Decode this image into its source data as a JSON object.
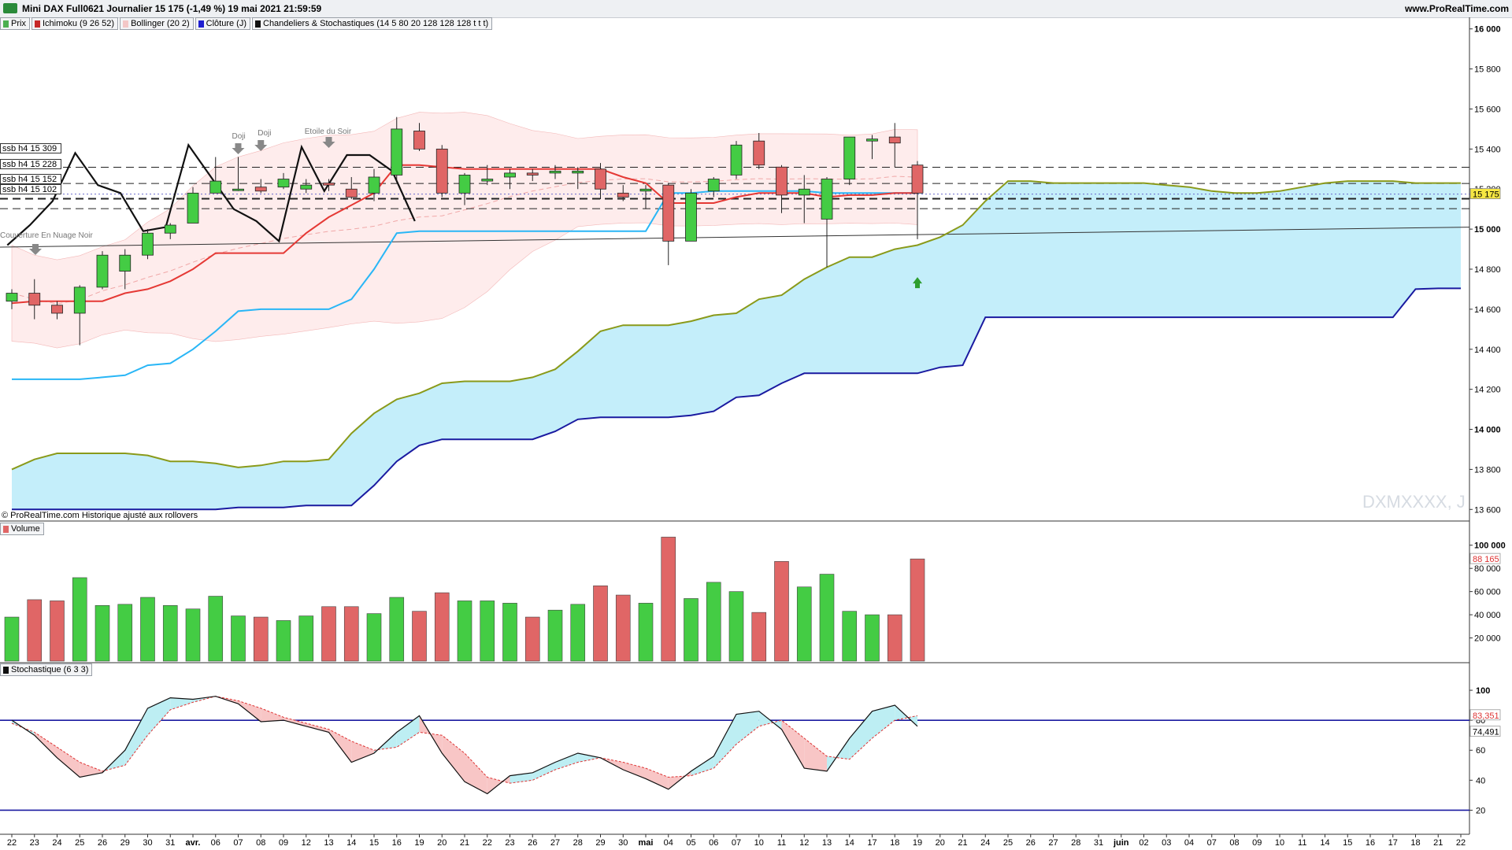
{
  "header": {
    "title": "Mini DAX Full0621 Journalier 15 175 (-1,49 %) 19 mai 2021 21:59:59",
    "site": "www.ProRealTime.com"
  },
  "legend": [
    {
      "label": "Prix",
      "color": "#4caf50"
    },
    {
      "label": "Ichimoku (9 26 52)",
      "color": "#c62828"
    },
    {
      "label": "Bollinger (20 2)",
      "color": "#f4c7c7"
    },
    {
      "label": "Clôture (J)",
      "color": "#1f1fd0"
    },
    {
      "label": "Chandeliers & Stochastiques (14 5 80 20 128 128 128 t t t)",
      "color": "#111111"
    }
  ],
  "footnote": "© ProRealTime.com Historique ajusté aux rollovers",
  "watermark": "DXMXXXX, J",
  "ssb_labels": [
    "ssb h4 15 309",
    "ssb h4 15 228",
    "ssb h4 15 152",
    "ssb h4 15 102"
  ],
  "annotations": {
    "doji1": "Doji",
    "doji2": "Doji",
    "etoile": "Etoile du Soir",
    "nuage": "Couverture En Nuage Noir",
    "last_price_tag": "15 175"
  },
  "volume_tag": "Volume",
  "stoch_tag": "Stochastique (6 3 3)",
  "colors": {
    "up": "#44cc44",
    "down": "#e06666",
    "tenkan": "#e53935",
    "kijun": "#29b6f6",
    "ssa": "#8a9a1a",
    "ssb": "#1a1aa0",
    "cloud": "#c4eefa",
    "boll": "#fde6e6",
    "stoch": "#111111"
  },
  "chart_data": [
    {
      "type": "candlestick",
      "x_labels": [
        "22",
        "23",
        "24",
        "25",
        "26",
        "29",
        "30",
        "31",
        "avr.",
        "06",
        "07",
        "08",
        "09",
        "12",
        "13",
        "14",
        "15",
        "16",
        "19",
        "20",
        "21",
        "22",
        "23",
        "26",
        "27",
        "28",
        "29",
        "30",
        "mai",
        "04",
        "05",
        "06",
        "07",
        "10",
        "11",
        "12",
        "13",
        "14",
        "17",
        "18",
        "19",
        "20",
        "21",
        "24",
        "25",
        "26",
        "27",
        "28",
        "31",
        "juin",
        "02",
        "03",
        "04",
        "07",
        "08",
        "09",
        "10",
        "11",
        "14",
        "15",
        "16",
        "17",
        "18",
        "21",
        "22"
      ],
      "ylim": [
        13550,
        16050
      ],
      "y_ticks": [
        "13 600",
        "13 800",
        "14 000",
        "14 200",
        "14 400",
        "14 600",
        "14 800",
        "15 000",
        "15 200",
        "15 400",
        "15 600",
        "15 800",
        "16 000"
      ],
      "candles": [
        [
          14640,
          14700,
          14600,
          14680
        ],
        [
          14680,
          14750,
          14550,
          14620
        ],
        [
          14620,
          14640,
          14550,
          14580
        ],
        [
          14580,
          14720,
          14420,
          14710
        ],
        [
          14710,
          14890,
          14700,
          14870
        ],
        [
          14790,
          14900,
          14700,
          14870
        ],
        [
          14870,
          15000,
          14850,
          14980
        ],
        [
          14980,
          15030,
          14950,
          15020
        ],
        [
          15030,
          15210,
          15040,
          15180
        ],
        [
          15180,
          15360,
          15180,
          15240
        ],
        [
          15200,
          15360,
          15190,
          15200
        ],
        [
          15210,
          15250,
          15180,
          15190
        ],
        [
          15210,
          15280,
          15200,
          15250
        ],
        [
          15200,
          15250,
          15180,
          15220
        ],
        [
          15230,
          15250,
          15190,
          15220
        ],
        [
          15200,
          15260,
          15150,
          15160
        ],
        [
          15180,
          15300,
          15140,
          15260
        ],
        [
          15270,
          15560,
          15240,
          15500
        ],
        [
          15490,
          15530,
          15390,
          15400
        ],
        [
          15400,
          15420,
          15160,
          15180
        ],
        [
          15180,
          15280,
          15120,
          15270
        ],
        [
          15240,
          15320,
          15220,
          15250
        ],
        [
          15260,
          15300,
          15200,
          15280
        ],
        [
          15280,
          15300,
          15240,
          15270
        ],
        [
          15280,
          15320,
          15250,
          15290
        ],
        [
          15280,
          15310,
          15200,
          15290
        ],
        [
          15300,
          15330,
          15150,
          15200
        ],
        [
          15180,
          15220,
          15140,
          15160
        ],
        [
          15190,
          15220,
          15100,
          15200
        ],
        [
          15220,
          15230,
          14820,
          14940
        ],
        [
          14940,
          15200,
          14940,
          15180
        ],
        [
          15190,
          15260,
          15160,
          15250
        ],
        [
          15270,
          15440,
          15250,
          15420
        ],
        [
          15440,
          15480,
          15300,
          15320
        ],
        [
          15310,
          15320,
          15080,
          15170
        ],
        [
          15170,
          15270,
          15030,
          15200
        ],
        [
          15050,
          15260,
          14810,
          15250
        ],
        [
          15250,
          15460,
          15220,
          15460
        ],
        [
          15440,
          15470,
          15350,
          15450
        ],
        [
          15460,
          15530,
          15310,
          15430
        ],
        [
          15320,
          15340,
          14950,
          15180
        ]
      ],
      "last_index": 40
    },
    {
      "type": "line",
      "name": "ichimoku",
      "tenkan": [
        14630,
        14640,
        14640,
        14640,
        14640,
        14680,
        14700,
        14740,
        14800,
        14880,
        14880,
        14880,
        14880,
        14980,
        15060,
        15120,
        15180,
        15320,
        15320,
        15310,
        15300,
        15300,
        15300,
        15300,
        15300,
        15300,
        15300,
        15260,
        15230,
        15130,
        15130,
        15130,
        15160,
        15180,
        15180,
        15180,
        15160,
        15170,
        15170,
        15180,
        15180
      ],
      "kijun": [
        14250,
        14250,
        14250,
        14250,
        14260,
        14270,
        14320,
        14330,
        14400,
        14490,
        14590,
        14600,
        14600,
        14600,
        14600,
        14650,
        14800,
        14980,
        14990,
        14990,
        14990,
        14990,
        14990,
        14990,
        14990,
        14990,
        14990,
        14990,
        14990,
        15180,
        15180,
        15190,
        15190,
        15190,
        15190,
        15190,
        15180,
        15180,
        15180,
        15180,
        15180
      ],
      "ssa": [
        13800,
        13850,
        13880,
        13880,
        13880,
        13880,
        13870,
        13840,
        13840,
        13830,
        13810,
        13820,
        13840,
        13840,
        13850,
        13980,
        14080,
        14150,
        14180,
        14230,
        14240,
        14240,
        14240,
        14260,
        14300,
        14390,
        14490,
        14520,
        14520,
        14520,
        14540,
        14570,
        14580,
        14650,
        14670,
        14750,
        14810,
        14860,
        14860,
        14900,
        14920,
        14960,
        15020,
        15140,
        15240,
        15240,
        15230,
        15230,
        15230,
        15230,
        15230,
        15220,
        15210,
        15190,
        15180,
        15180,
        15190,
        15210,
        15230,
        15240,
        15240,
        15240,
        15230,
        15230,
        15230
      ],
      "ssb": [
        13600,
        13600,
        13600,
        13600,
        13600,
        13600,
        13600,
        13600,
        13600,
        13600,
        13610,
        13610,
        13610,
        13620,
        13620,
        13620,
        13720,
        13840,
        13920,
        13950,
        13950,
        13950,
        13950,
        13950,
        13990,
        14050,
        14060,
        14060,
        14060,
        14060,
        14070,
        14090,
        14160,
        14170,
        14230,
        14280,
        14280,
        14280,
        14280,
        14280,
        14280,
        14310,
        14320,
        14560,
        14560,
        14560,
        14560,
        14560,
        14560,
        14560,
        14560,
        14560,
        14560,
        14560,
        14560,
        14560,
        14560,
        14560,
        14560,
        14560,
        14560,
        14560,
        14700,
        14704,
        14704
      ],
      "ssa_offset": 0
    },
    {
      "type": "line",
      "name": "chandeliers",
      "values": [
        14920,
        15020,
        15140,
        15380,
        15220,
        15180,
        14990,
        15010,
        15420,
        15260,
        15100,
        15040,
        14940,
        15410,
        15190,
        15370,
        15370,
        15290,
        15040
      ]
    },
    {
      "type": "bar",
      "name": "volume",
      "ylim": [
        0,
        110000
      ],
      "y_ticks": [
        "20 000",
        "40 000",
        "60 000",
        "80 000",
        "100 000"
      ],
      "values": [
        38000,
        53000,
        52000,
        72000,
        48000,
        49000,
        55000,
        48000,
        45000,
        56000,
        39000,
        38000,
        35000,
        39000,
        47000,
        47000,
        41000,
        55000,
        43000,
        59000,
        52000,
        52000,
        50000,
        38000,
        44000,
        49000,
        65000,
        57000,
        50000,
        107000,
        54000,
        68000,
        60000,
        42000,
        86000,
        64000,
        75000,
        43000,
        40000,
        40000,
        88165
      ],
      "last_value_tag": "88 165"
    },
    {
      "type": "line",
      "name": "stochastique",
      "ylim": [
        5,
        110
      ],
      "y_ticks": [
        "20",
        "40",
        "60",
        "80",
        "100"
      ],
      "k": [
        80,
        70,
        55,
        42,
        45,
        60,
        88,
        95,
        94,
        96,
        91,
        79,
        80,
        76,
        72,
        52,
        58,
        72,
        83,
        58,
        39,
        31,
        43,
        45,
        52,
        58,
        55,
        47,
        41,
        34,
        46,
        56,
        84,
        86,
        74,
        48,
        46,
        68,
        86,
        90,
        76
      ],
      "d": [
        78,
        72,
        62,
        52,
        46,
        50,
        70,
        87,
        92,
        96,
        93,
        88,
        82,
        78,
        74,
        66,
        60,
        62,
        72,
        70,
        58,
        42,
        38,
        40,
        47,
        52,
        55,
        52,
        48,
        42,
        43,
        48,
        64,
        76,
        80,
        68,
        56,
        54,
        68,
        80,
        83
      ],
      "levels": [
        80,
        20
      ],
      "tags": [
        "83,351",
        "74,491"
      ]
    }
  ]
}
